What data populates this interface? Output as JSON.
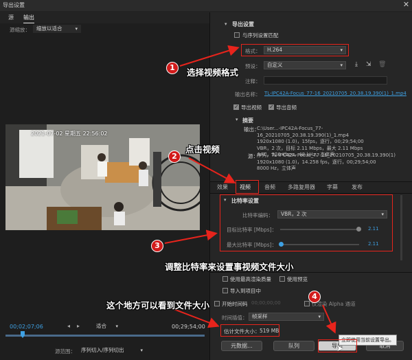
{
  "window": {
    "title": "导出设置"
  },
  "top_tabs": [
    "源",
    "输出"
  ],
  "source": {
    "scale_label": "源缩放：",
    "scale_value": "缩放以适合"
  },
  "video_overlay": "2021-07-02  星期五 22:56:02",
  "timeline": {
    "current_time": "00;02;07;06",
    "fit": "适合",
    "end_time": "00;29;54;00",
    "range_label": "源范围：",
    "range_value": "序列切入/序列切出"
  },
  "export_settings": {
    "header": "导出设置",
    "match_sequence": "与序列设置匹配",
    "format_label": "格式：",
    "format_value": "H.264",
    "preset_label": "预设：",
    "preset_value": "自定义",
    "comment_label": "注释：",
    "output_name_label": "输出名称：",
    "output_name_value": "TL-IPC42A-Focus_77-16_20210705_20.38.19.390(1)_1.mp4",
    "export_video": "导出视频",
    "export_audio": "导出音频"
  },
  "summary": {
    "header": "摘要",
    "output_label": "输出：",
    "output_lines": [
      "C:\\User...-IPC42A-Focus_77-16_20210705_20.38.19.390(1)_1.mp4",
      "1920x1080 (1.0)，15fps，逐行，00;29;54;00",
      "VBR，2 次，目标 2.11 Mbps，最大 2.11 Mbps",
      "AAC，320 Kbps，48 kHz，立体声"
    ],
    "source_label": "源：",
    "source_lines": [
      "序列，TL-IPC42A-Focus_77-16_20210705_20.38.19.390(1)",
      "1920x1080 (1.0)，14.258 fps，逐行，00;29;54;00",
      "8000 Hz，立体声"
    ]
  },
  "tabs": [
    "效果",
    "视频",
    "音频",
    "多路复用器",
    "字幕",
    "发布"
  ],
  "bitrate": {
    "header": "比特率设置",
    "encoding_label": "比特率编码：",
    "encoding_value": "VBR，2 次",
    "target_label": "目标比特率 [Mbps]：",
    "target_value": "2.11",
    "max_label": "最大比特率 [Mbps]：",
    "max_value": "2.11"
  },
  "bottom": {
    "max_render": "使用最高渲染质量",
    "use_preview": "使用预览",
    "import_project": "导入到项目中",
    "set_start": "开始时间码",
    "start_tc": "00;00;00;00",
    "render_alpha": "仅渲染 Alpha 通道",
    "time_interp_label": "时间插值：",
    "time_interp_value": "帧采样",
    "est_size_label": "估计文件大小：",
    "est_size_value": "519 MB",
    "metadata_btn": "元数据...",
    "queue_btn": "队列",
    "export_btn": "导出",
    "cancel_btn": "取消",
    "tooltip": "立即使用当前设置导出。"
  },
  "annotations": {
    "a1": "选择视频格式",
    "a2": "点击视频",
    "a3": "调整比特率来设置事视频文件大小",
    "a4": "这个地方可以看到文件大小",
    "n1": "1",
    "n2": "2",
    "n3": "3",
    "n4": "4"
  },
  "colors": {
    "annotation_red": "#e8241c",
    "accent_blue": "#3ea1e4"
  }
}
